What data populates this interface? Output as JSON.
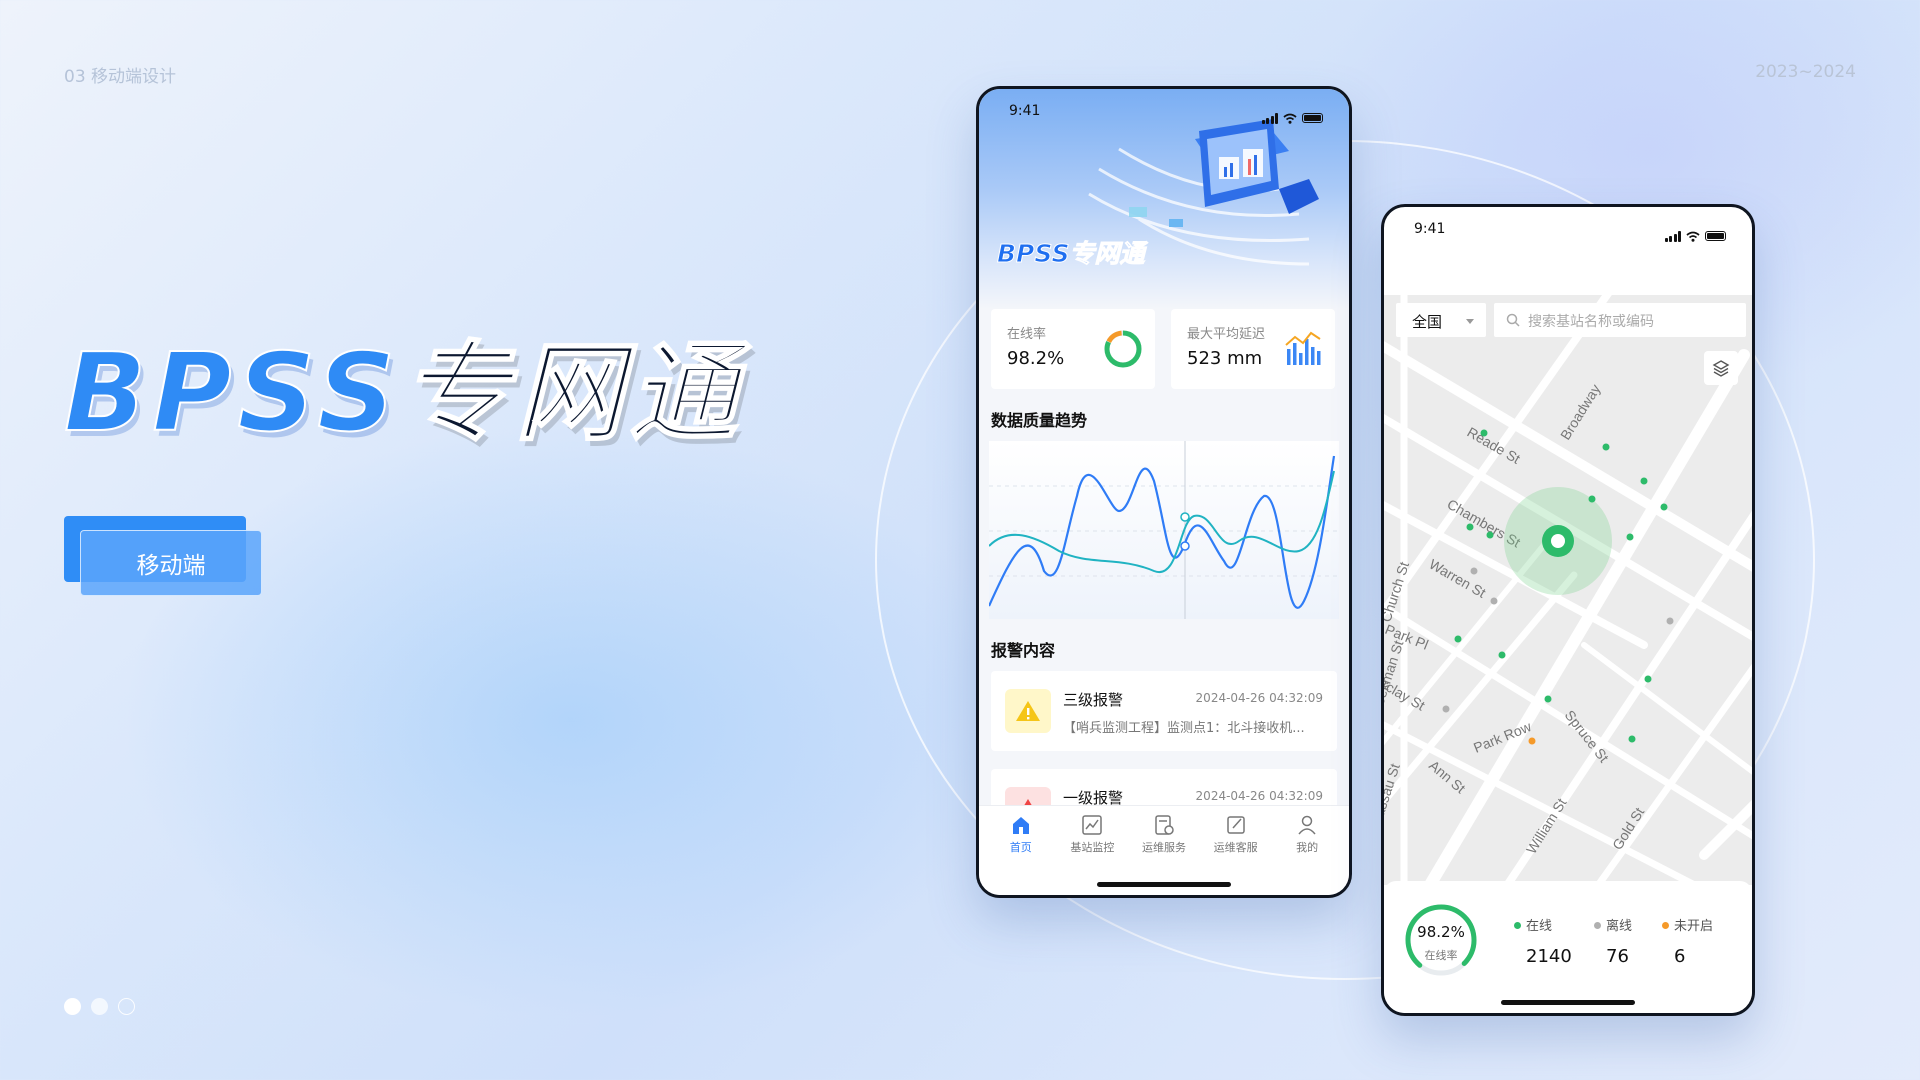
{
  "page": {
    "section_label": "03 移动端设计",
    "year_label": "2023~2024",
    "brand_latin": "BPSS",
    "brand_cjk": "专网通",
    "tag_label": "移动端"
  },
  "colors": {
    "accent": "#2f8df6",
    "online": "#2dbb6a",
    "offline": "#b0b0b0",
    "inactive": "#f59a2a",
    "warning_bg": "#fff7c9",
    "danger_bg": "#fde1e1"
  },
  "phone_a": {
    "time": "9:41",
    "hero_title": "BPSS专网通",
    "kpis": [
      {
        "label": "在线率",
        "value": "98.2%",
        "online_fraction": 0.82
      },
      {
        "label": "最大平均延迟",
        "value": "523 mm"
      }
    ],
    "trend_title": "数据质量趋势",
    "alarm_title": "报警内容",
    "alarms": [
      {
        "level": "三级报警",
        "time": "2024-04-26 04:32:09",
        "desc": "【哨兵监测工程】监测点1：北斗接收机..."
      },
      {
        "level": "一级报警",
        "time": "2024-04-26 04:32:09",
        "desc": ""
      }
    ],
    "tabs": [
      {
        "label": "首页",
        "icon": "home-icon"
      },
      {
        "label": "基站监控",
        "icon": "chart-icon"
      },
      {
        "label": "运维服务",
        "icon": "service-icon"
      },
      {
        "label": "运维客服",
        "icon": "edit-icon"
      },
      {
        "label": "我的",
        "icon": "user-icon"
      }
    ]
  },
  "phone_b": {
    "time": "9:41",
    "region": "全国",
    "search_placeholder": "搜索基站名称或编码",
    "streets": [
      "Broadway",
      "Reade St",
      "Chambers St",
      "Warren St",
      "Church St",
      "Park Pl",
      "Barclay St",
      "Park Row",
      "Spruce St",
      "Ann St",
      "William St",
      "Gold St",
      "Nassau St",
      "Beekman St"
    ],
    "online_rate": "98.2%",
    "online_rate_label": "在线率",
    "online_rate_fraction": 0.982,
    "stats": [
      {
        "label": "在线",
        "value": "2140"
      },
      {
        "label": "离线",
        "value": "76"
      },
      {
        "label": "未开启",
        "value": "6"
      }
    ]
  }
}
